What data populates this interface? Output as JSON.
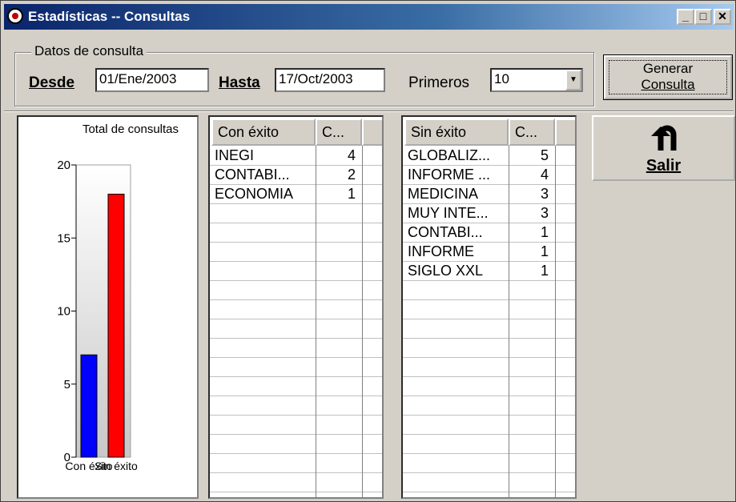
{
  "window": {
    "title": "Estadísticas -- Consultas",
    "minimize": "_",
    "maximize": "□",
    "close": "✕"
  },
  "query": {
    "group_label": "Datos de consulta",
    "desde_label": "Desde",
    "desde_value": "01/Ene/2003",
    "hasta_label": "Hasta",
    "hasta_value": "17/Oct/2003",
    "primeros_label": "Primeros",
    "primeros_value": "10",
    "generate_line1": "Generar",
    "generate_line2": "Consulta"
  },
  "exit_button": {
    "label": "Salir",
    "icon": "u-turn-arrow-icon"
  },
  "success_table": {
    "col1": "Con éxito",
    "col2": "C...",
    "rows": [
      {
        "name": "INEGI",
        "count": "4"
      },
      {
        "name": "CONTABI...",
        "count": "2"
      },
      {
        "name": "ECONOMIA",
        "count": "1"
      }
    ]
  },
  "fail_table": {
    "col1": "Sin éxito",
    "col2": "C...",
    "rows": [
      {
        "name": "GLOBALIZ...",
        "count": "5"
      },
      {
        "name": "INFORME ...",
        "count": "4"
      },
      {
        "name": "MEDICINA",
        "count": "3"
      },
      {
        "name": "MUY INTE...",
        "count": "3"
      },
      {
        "name": "CONTABI...",
        "count": "1"
      },
      {
        "name": "INFORME",
        "count": "1"
      },
      {
        "name": "SIGLO XXL",
        "count": "1"
      }
    ]
  },
  "chart_data": {
    "type": "bar",
    "title": "Total de consultas",
    "categories": [
      "Con éxito",
      "Sin éxito"
    ],
    "values": [
      7,
      18
    ],
    "colors": [
      "#0000ff",
      "#ff0000"
    ],
    "ylim": [
      0,
      20
    ],
    "yticks": [
      "0",
      "5",
      "10",
      "15",
      "20"
    ]
  }
}
